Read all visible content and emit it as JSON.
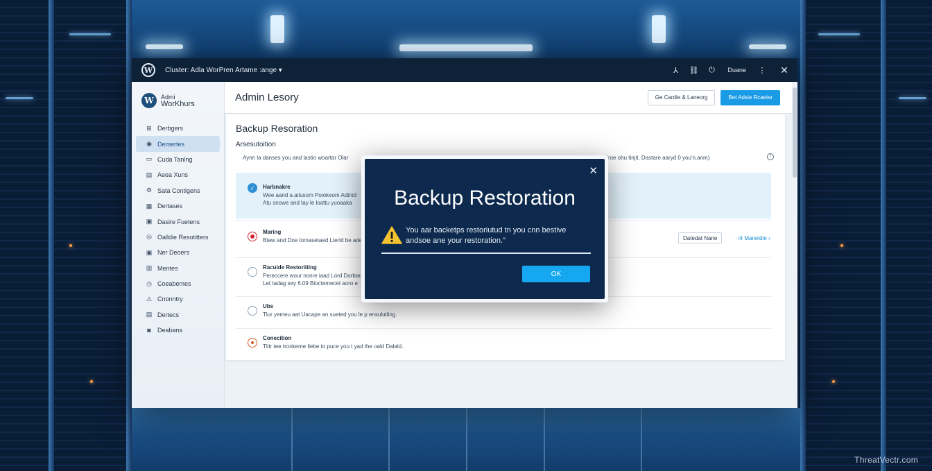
{
  "window": {
    "title": "Cluster: Adla WorPren Artame :ange ▾",
    "toolbar_text": "Duane",
    "brand_line1": "Admi",
    "brand_line2": "WorKhurs"
  },
  "sidebar": {
    "items": [
      {
        "label": "Derbgers",
        "icon": "dashboard-icon",
        "glyph": "⊞"
      },
      {
        "label": "Demertes",
        "icon": "pages-icon",
        "glyph": "◉"
      },
      {
        "label": "Cuda Tanlng",
        "icon": "tools-icon",
        "glyph": "▭"
      },
      {
        "label": "Aeea Xuns",
        "icon": "media-icon",
        "glyph": "▤"
      },
      {
        "label": "Sata Contigens",
        "icon": "settings-icon",
        "glyph": "⚙"
      },
      {
        "label": "Dertases",
        "icon": "database-icon",
        "glyph": "▦"
      },
      {
        "label": "Dasire Fuetens",
        "icon": "functions-icon",
        "glyph": "▣"
      },
      {
        "label": "Oalldie Resotitters",
        "icon": "restore-icon",
        "glyph": "◎"
      },
      {
        "label": "Ner Deoers",
        "icon": "users-icon",
        "glyph": "▣"
      },
      {
        "label": "Mentes",
        "icon": "menus-icon",
        "glyph": "▥"
      },
      {
        "label": "Coeabemes",
        "icon": "clock-icon",
        "glyph": "◷"
      },
      {
        "label": "Cnonntry",
        "icon": "alert-icon",
        "glyph": "⚠"
      },
      {
        "label": "Dertecs",
        "icon": "devices-icon",
        "glyph": "▤"
      },
      {
        "label": "Deabans",
        "icon": "logs-icon",
        "glyph": "◙"
      }
    ],
    "active_index": 1
  },
  "header": {
    "title": "Admin Lesory",
    "secondary_button": "Ge Cardie & Laneorg",
    "primary_button": "Bet Adsie Rcaetsr"
  },
  "panel": {
    "title": "Backup Resoration",
    "subtitle": "Arsesutoition",
    "description": "Aynn la danses you and lastio woartar Olar",
    "description_right": "Froe ohu tinjit.    Dastare aaryd 0 you'n.anm)",
    "options": [
      {
        "title": "Harbnakre",
        "line1": "Wee aand a.ailusom  Poiokeom Adtnid",
        "line2": "Atu snowe and tay le loattu yuoaaka",
        "state": "checked"
      },
      {
        "title": "Maring",
        "line1": "Btaw and Dne tomasetaed Lterld be ade",
        "state": "error",
        "button": "Datedat Nane",
        "link": "· l4 Maneldie ›"
      },
      {
        "title": "Racuide Restoriiting",
        "line1": "Pereccere wour nonre iaad Lord Dorbaras",
        "line2": "Let tadag sey 6.09 Bioctemecet aoro e",
        "state": "empty"
      },
      {
        "title": "Ubs",
        "line1": "Tlur yemeu aat Uacape an sueted you le p ensulutiing.",
        "state": "empty"
      },
      {
        "title": "Conecition",
        "line1": "Tlitr tee tronkeme liebe to puce you t yad the oald Dalald.",
        "state": "warning"
      }
    ]
  },
  "modal": {
    "title": "Backup Restoration",
    "message_line1": "You aar backetps restoriutud tn you cnn bestive",
    "message_line2": "andsoe ane your restoration.\"",
    "ok_label": "OK"
  },
  "watermark": "ThreatVectr.com",
  "colors": {
    "accent": "#1a9be6",
    "titlebar": "#0d2137",
    "modal_bg": "#0d2a4e",
    "warning": "#f2c230",
    "error": "#d6262f"
  }
}
